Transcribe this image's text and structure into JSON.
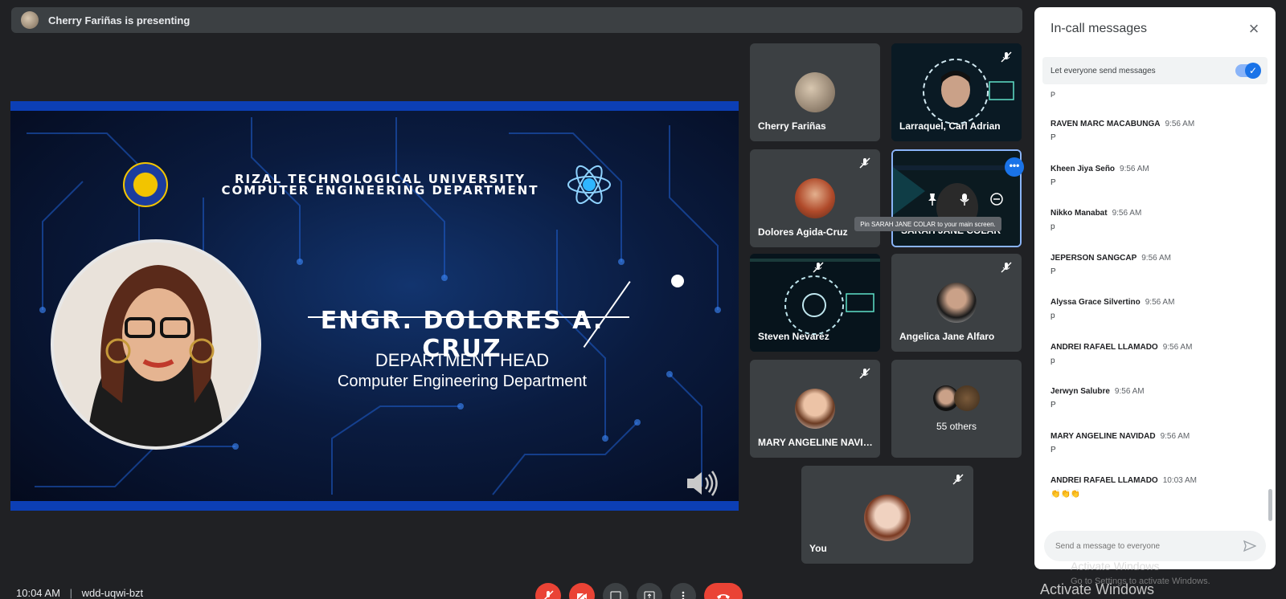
{
  "presenting": {
    "text": "Cherry Fariñas is presenting"
  },
  "slide": {
    "university": "RIZAL TECHNOLOGICAL UNIVERSITY",
    "department": "COMPUTER ENGINEERING DEPARTMENT",
    "name": "ENGR. DOLORES A. CRUZ",
    "position": "DEPARTMENT HEAD",
    "dept_full": "Computer Engineering Department"
  },
  "participants": [
    {
      "name": "Cherry Fariñas",
      "muted": false
    },
    {
      "name": "Larraquel, Carl Adrian",
      "muted": true
    },
    {
      "name": "Dolores Agida-Cruz",
      "muted": true
    },
    {
      "name": "SARAH JANE COLAR",
      "muted": false
    },
    {
      "name": "Steven Nevarez",
      "muted": true
    },
    {
      "name": "Angelica Jane Alfaro",
      "muted": true
    },
    {
      "name": "MARY ANGELINE NAVID...",
      "muted": true
    },
    {
      "name": "55 others",
      "muted": false
    },
    {
      "name": "You",
      "muted": true
    }
  ],
  "tooltip": {
    "pin": "Pin SARAH JANE COLAR to your main screen."
  },
  "chat": {
    "title": "In-call messages",
    "setting_label": "Let everyone send messages",
    "stray": "P",
    "messages": [
      {
        "sender": "RAVEN MARC MACABUNGA",
        "time": "9:56 AM",
        "text": "P"
      },
      {
        "sender": "Kheen Jiya Seño",
        "time": "9:56 AM",
        "text": "P"
      },
      {
        "sender": "Nikko Manabat",
        "time": "9:56 AM",
        "text": "p"
      },
      {
        "sender": "JEPERSON SANGCAP",
        "time": "9:56 AM",
        "text": "P"
      },
      {
        "sender": "Alyssa Grace Silvertino",
        "time": "9:56 AM",
        "text": "p"
      },
      {
        "sender": "ANDREI RAFAEL LLAMADO",
        "time": "9:56 AM",
        "text": "p"
      },
      {
        "sender": "Jerwyn Salubre",
        "time": "9:56 AM",
        "text": "P"
      },
      {
        "sender": "MARY ANGELINE NAVIDAD",
        "time": "9:56 AM",
        "text": "P"
      },
      {
        "sender": "ANDREI RAFAEL LLAMADO",
        "time": "10:03 AM",
        "text": "👏👏👏"
      }
    ],
    "input_placeholder": "Send a message to everyone"
  },
  "meeting": {
    "time": "10:04 AM",
    "separator": "|",
    "code": "wdd-uqwi-bzt"
  },
  "windows": {
    "activate": "Activate Windows",
    "activate_sub": "Activate Windows",
    "activate_sub2": "Go to Settings to activate Windows."
  },
  "colors": {
    "accent": "#1a73e8",
    "end_call": "#ea4335",
    "background": "#202124",
    "tile": "#3c4043"
  }
}
